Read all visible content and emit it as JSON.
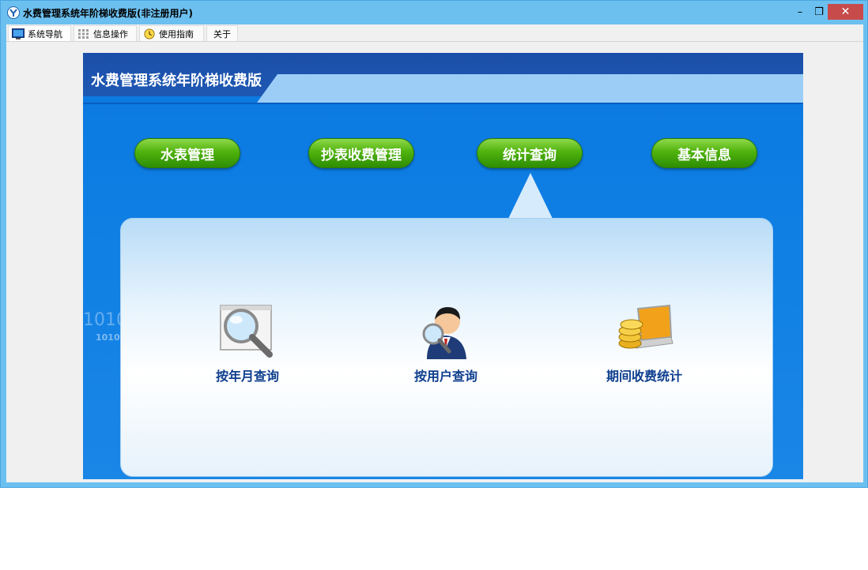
{
  "window": {
    "title": "水费管理系统年阶梯收费版(非注册用户)",
    "controls": {
      "minimize": "–",
      "restore": "❐",
      "close": "✕"
    }
  },
  "tabs": [
    {
      "label": "系统导航",
      "icon": "monitor-icon"
    },
    {
      "label": "信息操作",
      "icon": "grid-icon"
    },
    {
      "label": "使用指南",
      "icon": "clock-icon"
    },
    {
      "label": "关于"
    }
  ],
  "banner": {
    "title": "水费管理系统年阶梯收费版"
  },
  "nav_buttons": [
    "水表管理",
    "抄表收费管理",
    "统计查询",
    "基本信息"
  ],
  "features": [
    {
      "label": "按年月查询",
      "icon": "magnifier-window-icon"
    },
    {
      "label": "按用户查询",
      "icon": "user-search-icon"
    },
    {
      "label": "期间收费统计",
      "icon": "coins-laptop-icon"
    }
  ],
  "background_text": {
    "line1": "1010",
    "line2": "1010"
  },
  "colors": {
    "accent_blue": "#0f7fe4",
    "button_green": "#4fb20c",
    "close_red": "#c74b4b"
  }
}
